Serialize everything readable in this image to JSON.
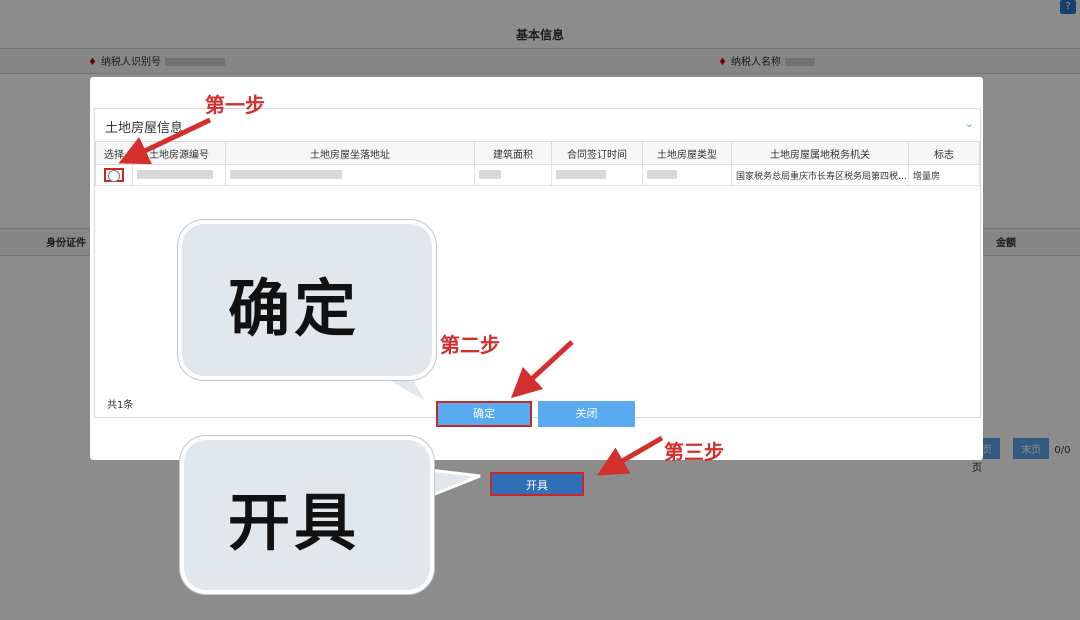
{
  "background": {
    "title": "基本信息",
    "field1_label": "纳税人识别号",
    "field2_label": "纳税人名称",
    "col_id": "身份证件",
    "col_amount": "金额",
    "pager_prev": "页",
    "pager_last": "末页",
    "pager_info": "0/0页",
    "issue_button": "开具"
  },
  "modal": {
    "section_title": "土地房屋信息",
    "columns": [
      "选择",
      "土地房源编号",
      "土地房屋坐落地址",
      "建筑面积",
      "合同签订时间",
      "土地房屋类型",
      "土地房屋属地税务机关",
      "标志"
    ],
    "row": {
      "tax_office": "国家税务总局重庆市长寿区税务局第四税…",
      "flag": "增量房"
    },
    "count_text": "共1条",
    "ok_button": "确定",
    "close_button": "关闭"
  },
  "annotations": {
    "step1": "第一步",
    "step2": "第二步",
    "step3": "第三步",
    "bubble_confirm": "确定",
    "bubble_issue": "开具"
  },
  "colors": {
    "annotation_red": "#d32f2f",
    "button_blue": "#5aaaf0",
    "issue_blue": "#2e6fb5"
  }
}
